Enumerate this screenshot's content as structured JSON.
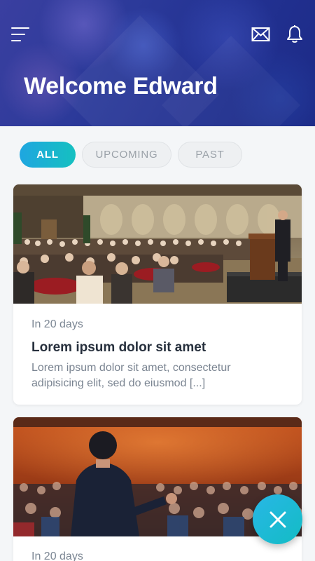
{
  "header": {
    "greeting": "Welcome Edward",
    "menu_icon": "menu-icon",
    "mail_icon": "mail-icon",
    "notification_icon": "bell-icon"
  },
  "filters": {
    "selected": "ALL",
    "tabs": [
      {
        "label": "ALL"
      },
      {
        "label": "UPCOMING"
      },
      {
        "label": "PAST"
      }
    ]
  },
  "events": [
    {
      "when": "In 20 days",
      "title": "Lorem ipsum dolor sit amet",
      "description": "Lorem ipsum dolor sit amet, consectetur adipisicing elit, sed do eiusmod [...]",
      "image": "conference-banquet-hall-speaker-photo"
    },
    {
      "when": "In 20 days",
      "image": "speaker-facing-audience-photo"
    }
  ],
  "fab": {
    "icon": "close-icon"
  },
  "colors": {
    "accent_start": "#1fa6e0",
    "accent_end": "#15c0c0",
    "header_bg": "#233293",
    "text_primary": "#27303d",
    "text_secondary": "#7a8491"
  }
}
